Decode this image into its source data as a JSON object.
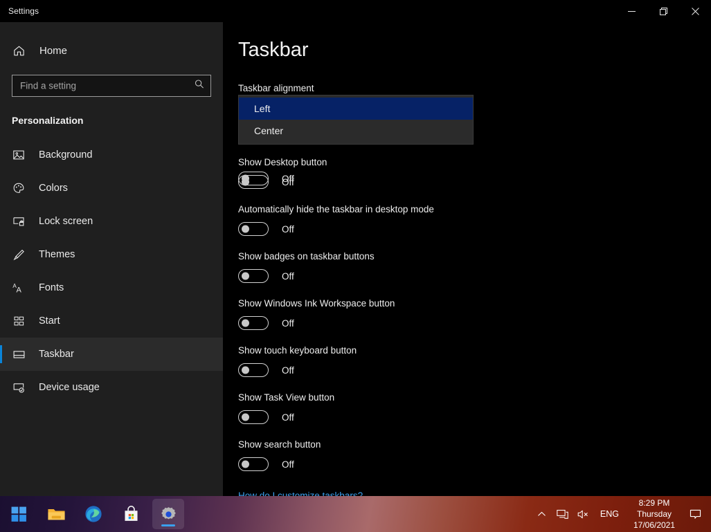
{
  "window": {
    "title": "Settings",
    "controls": {
      "minimize": "minimize-icon",
      "restore": "restore-icon",
      "close": "close-icon"
    }
  },
  "sidebar": {
    "home_label": "Home",
    "home_icon": "home-icon",
    "search": {
      "placeholder": "Find a setting",
      "value": "",
      "icon": "search-icon"
    },
    "category": "Personalization",
    "items": [
      {
        "label": "Background",
        "icon": "image-icon",
        "selected": false
      },
      {
        "label": "Colors",
        "icon": "palette-icon",
        "selected": false
      },
      {
        "label": "Lock screen",
        "icon": "lock-screen-icon",
        "selected": false
      },
      {
        "label": "Themes",
        "icon": "brush-icon",
        "selected": false
      },
      {
        "label": "Fonts",
        "icon": "fonts-icon",
        "selected": false
      },
      {
        "label": "Start",
        "icon": "start-tiles-icon",
        "selected": false
      },
      {
        "label": "Taskbar",
        "icon": "taskbar-icon",
        "selected": true
      },
      {
        "label": "Device usage",
        "icon": "device-usage-icon",
        "selected": false
      }
    ]
  },
  "main": {
    "page_title": "Taskbar",
    "alignment_label": "Taskbar alignment",
    "dropdown": {
      "open": true,
      "selected": "Left",
      "options": [
        "Left",
        "Center"
      ]
    },
    "first_toggle_value": "Off",
    "settings": [
      {
        "label": "Show Desktop button",
        "value": "Off"
      },
      {
        "label": "Automatically hide the taskbar in desktop mode",
        "value": "Off"
      },
      {
        "label": "Show badges on taskbar buttons",
        "value": "Off"
      },
      {
        "label": "Show Windows Ink Workspace button",
        "value": "Off"
      },
      {
        "label": "Show touch keyboard button",
        "value": "Off"
      },
      {
        "label": "Show Task View button",
        "value": "Off"
      },
      {
        "label": "Show search button",
        "value": "Off"
      }
    ],
    "help_link": "How do I customize taskbars?"
  },
  "taskbar": {
    "apps": [
      {
        "name": "start-button",
        "icon": "windows-logo-icon",
        "active": false
      },
      {
        "name": "file-explorer",
        "icon": "folder-icon",
        "active": false
      },
      {
        "name": "microsoft-edge",
        "icon": "edge-icon",
        "active": false
      },
      {
        "name": "microsoft-store",
        "icon": "store-bag-icon",
        "active": false
      },
      {
        "name": "settings-app",
        "icon": "gear-icon",
        "active": true
      }
    ],
    "tray": {
      "chevron": "chevron-up-icon",
      "network": "network-icon",
      "volume": "volume-muted-icon",
      "language": "ENG",
      "time": "8:29 PM",
      "day": "Thursday",
      "date": "17/06/2021",
      "notifications": "notification-bubble-icon"
    }
  },
  "colors": {
    "accent": "#0a84d8",
    "sidebar_bg": "#1f1f1f",
    "content_bg": "#000000",
    "dropdown_bg": "#2b2b2b",
    "dropdown_selected": "#062266",
    "link": "#3aa0ee"
  }
}
